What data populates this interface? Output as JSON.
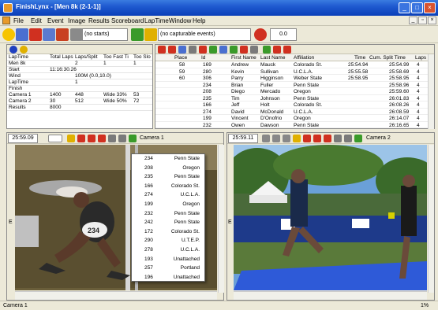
{
  "window": {
    "title": "FinishLynx - [Men 8k (2-1-1)]"
  },
  "menu": [
    "File",
    "Edit",
    "Event",
    "Image",
    "Results",
    "Scoreboard",
    "LapTime",
    "Window",
    "Help"
  ],
  "toolbar": {
    "start_field": "(no starts)",
    "capture_field": "(no capturable events)",
    "time_value": "0.0"
  },
  "event_info": {
    "rows": [
      {
        "c1": "LapTime",
        "c2": "Total Laps",
        "c3": "Laps/Split",
        "c4": "Too Fast Ti",
        "c5": "Too Slo"
      },
      {
        "c1": "Men 8k",
        "c2": "",
        "c3": "2",
        "c4": "1",
        "c5": "1"
      },
      {
        "c1": "Start",
        "c2": "11:16:30.26",
        "c3": "",
        "c4": "",
        "c5": ""
      },
      {
        "c1": "Wind",
        "c2": "",
        "c3": "100M (0.0,10.0)",
        "c4": "",
        "c5": ""
      },
      {
        "c1": "LapTime",
        "c2": "",
        "c3": "1",
        "c4": "",
        "c5": ""
      },
      {
        "c1": "Finish",
        "c2": "",
        "c3": "",
        "c4": "",
        "c5": ""
      },
      {
        "c1": "Camera 1",
        "c2": "1400",
        "c3": "448",
        "c4": "Wide 33%",
        "c5": "53"
      },
      {
        "c1": "Camera 2",
        "c2": "30",
        "c3": "512",
        "c4": "Wide 50%",
        "c5": "72"
      },
      {
        "c1": "Results",
        "c2": "8000",
        "c3": "",
        "c4": "",
        "c5": ""
      }
    ]
  },
  "results": {
    "headers": [
      "Place",
      "Id",
      "First Name",
      "Last Name",
      "Affiliation",
      "Time",
      "Cum. Split Time",
      "Laps"
    ],
    "rows": [
      {
        "place": "58",
        "id": "169",
        "first": "Andrew",
        "last": "Mauck",
        "aff": "Colorado St.",
        "time": "25:54.94",
        "cum": "25:54.99",
        "laps": "4"
      },
      {
        "place": "59",
        "id": "280",
        "first": "Kevin",
        "last": "Sullivan",
        "aff": "U.C.L.A.",
        "time": "25:55.58",
        "cum": "25:58.69",
        "laps": "4"
      },
      {
        "place": "60",
        "id": "306",
        "first": "Parry",
        "last": "Higginson",
        "aff": "Weber State",
        "time": "25:58.95",
        "cum": "25:58.95",
        "laps": "4"
      },
      {
        "place": "",
        "id": "234",
        "first": "Brian",
        "last": "Fuller",
        "aff": "Penn State",
        "time": "",
        "cum": "25:58.96",
        "laps": "4"
      },
      {
        "place": "",
        "id": "208",
        "first": "Diego",
        "last": "Mercado",
        "aff": "Oregon",
        "time": "",
        "cum": "25:59.60",
        "laps": "4"
      },
      {
        "place": "",
        "id": "235",
        "first": "Tim",
        "last": "Johnson",
        "aff": "Penn State",
        "time": "",
        "cum": "26:01.83",
        "laps": "4"
      },
      {
        "place": "",
        "id": "166",
        "first": "Jeff",
        "last": "Holt",
        "aff": "Colorado St.",
        "time": "",
        "cum": "26:08.26",
        "laps": "4"
      },
      {
        "place": "",
        "id": "274",
        "first": "David",
        "last": "McDonald",
        "aff": "U.C.L.A.",
        "time": "",
        "cum": "26:08.59",
        "laps": "4"
      },
      {
        "place": "",
        "id": "199",
        "first": "Vincent",
        "last": "D'Onofrio",
        "aff": "Oregon",
        "time": "",
        "cum": "26:14.07",
        "laps": "4"
      },
      {
        "place": "",
        "id": "232",
        "first": "Owen",
        "last": "Dawson",
        "aff": "Penn State",
        "time": "",
        "cum": "26:16.65",
        "laps": "4"
      }
    ]
  },
  "camera1": {
    "time": "25:59.09",
    "label": "Camera 1",
    "bib": "234"
  },
  "camera2": {
    "time": "25:59.11",
    "label": "Camera 2"
  },
  "popup_list": [
    {
      "id": "234",
      "aff": "Penn State"
    },
    {
      "id": "208",
      "aff": "Oregon"
    },
    {
      "id": "235",
      "aff": "Penn State"
    },
    {
      "id": "166",
      "aff": "Colorado St."
    },
    {
      "id": "274",
      "aff": "U.C.L.A."
    },
    {
      "id": "199",
      "aff": "Oregon"
    },
    {
      "id": "232",
      "aff": "Penn State"
    },
    {
      "id": "242",
      "aff": "Penn State"
    },
    {
      "id": "172",
      "aff": "Colorado St."
    },
    {
      "id": "290",
      "aff": "U.T.E.P."
    },
    {
      "id": "278",
      "aff": "U.C.L.A."
    },
    {
      "id": "193",
      "aff": "Unattached"
    },
    {
      "id": "257",
      "aff": "Portland"
    },
    {
      "id": "196",
      "aff": "Unattached"
    }
  ],
  "status": {
    "left": "Camera 1",
    "right": "1%"
  },
  "scroll_marker": "E",
  "colors": {
    "titlebar": "#1f5ad0",
    "accent_red": "#d03020",
    "accent_green": "#3a9a2a"
  }
}
